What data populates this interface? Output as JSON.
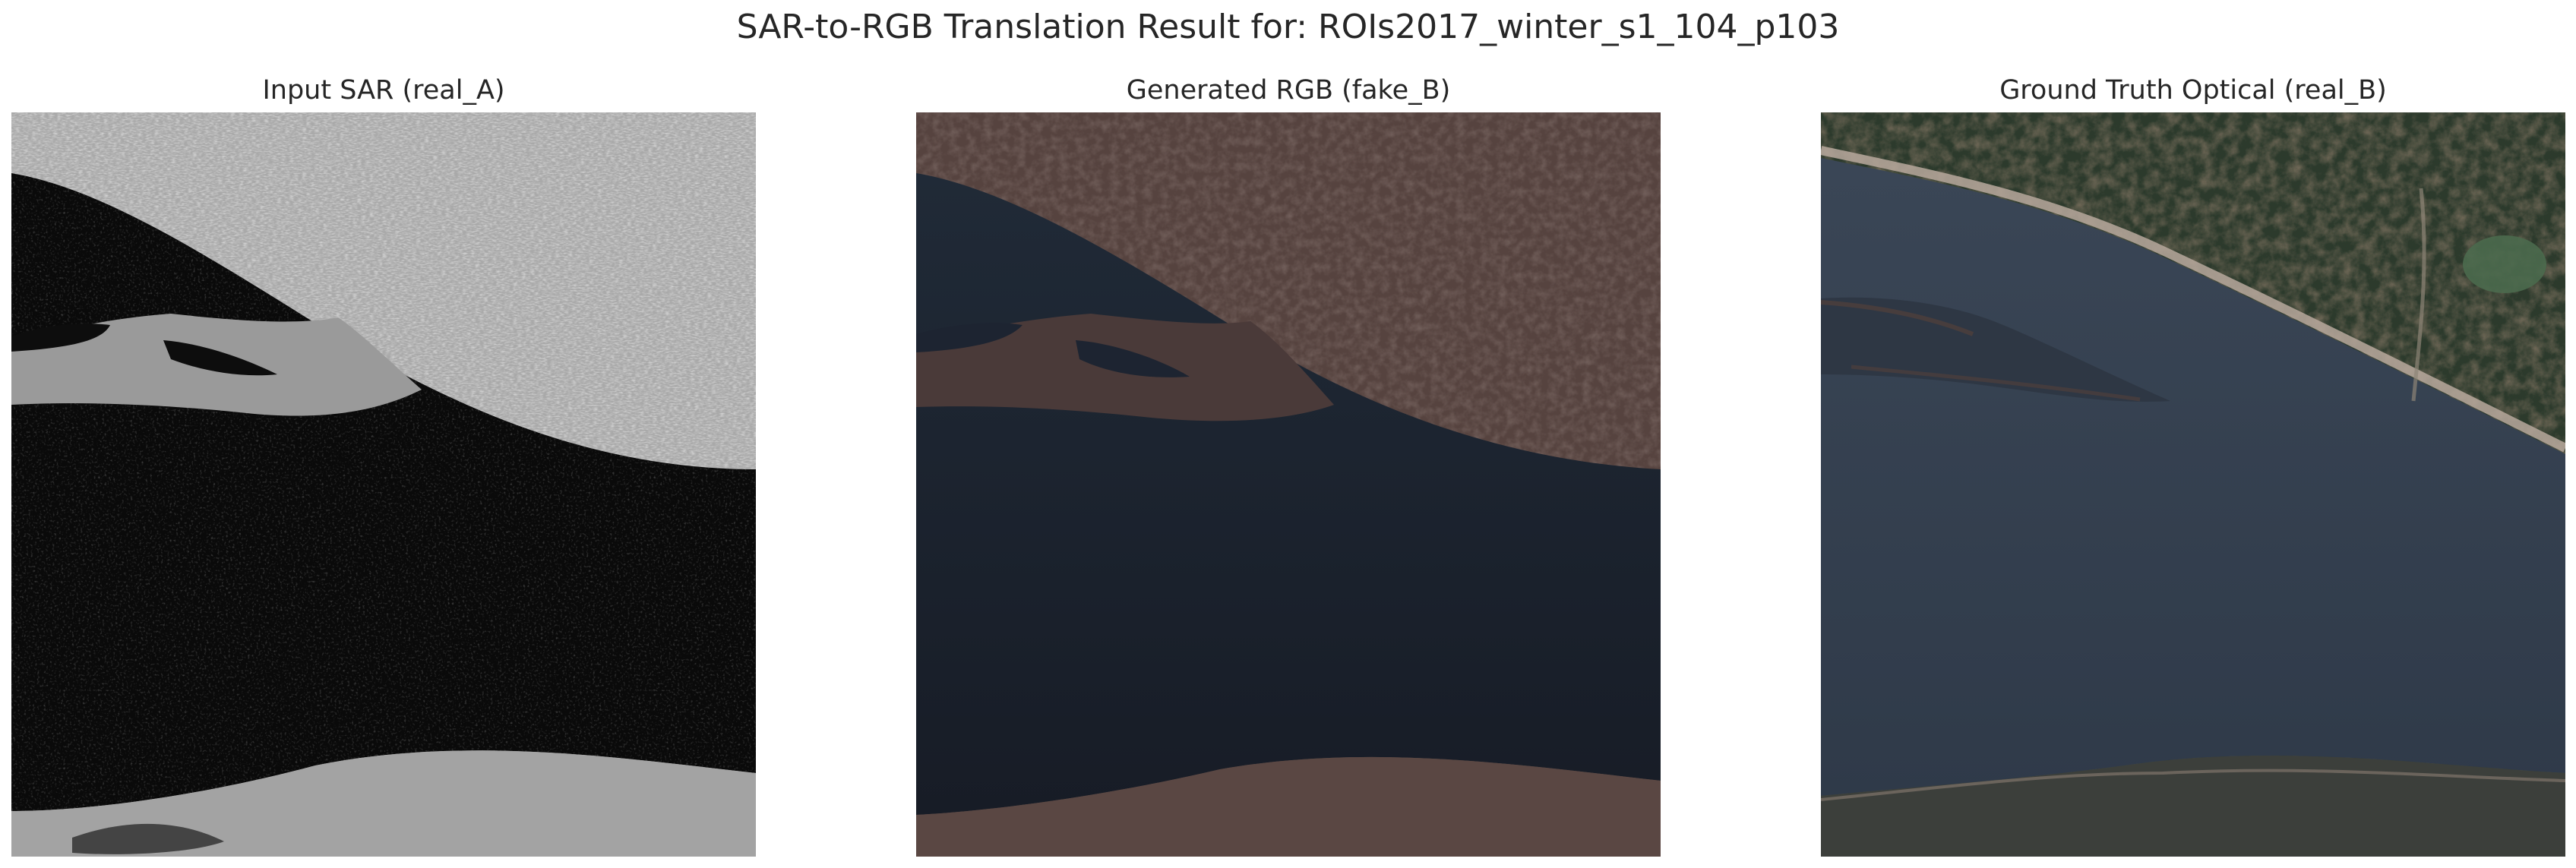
{
  "figure": {
    "suptitle": "SAR-to-RGB Translation Result for: ROIs2017_winter_s1_104_p103",
    "panels": [
      {
        "title": "Input SAR (real_A)"
      },
      {
        "title": "Generated RGB (fake_B)"
      },
      {
        "title": "Ground Truth Optical (real_B)"
      }
    ]
  },
  "colors": {
    "sar_land": "#a9a9a9",
    "sar_water": "#0a0a0a",
    "fake_land": "#56433f",
    "fake_water": "#1b2230",
    "optical_land": "#2c3a2c",
    "optical_water": "#34404f",
    "optical_shore": "#b9a99d"
  }
}
